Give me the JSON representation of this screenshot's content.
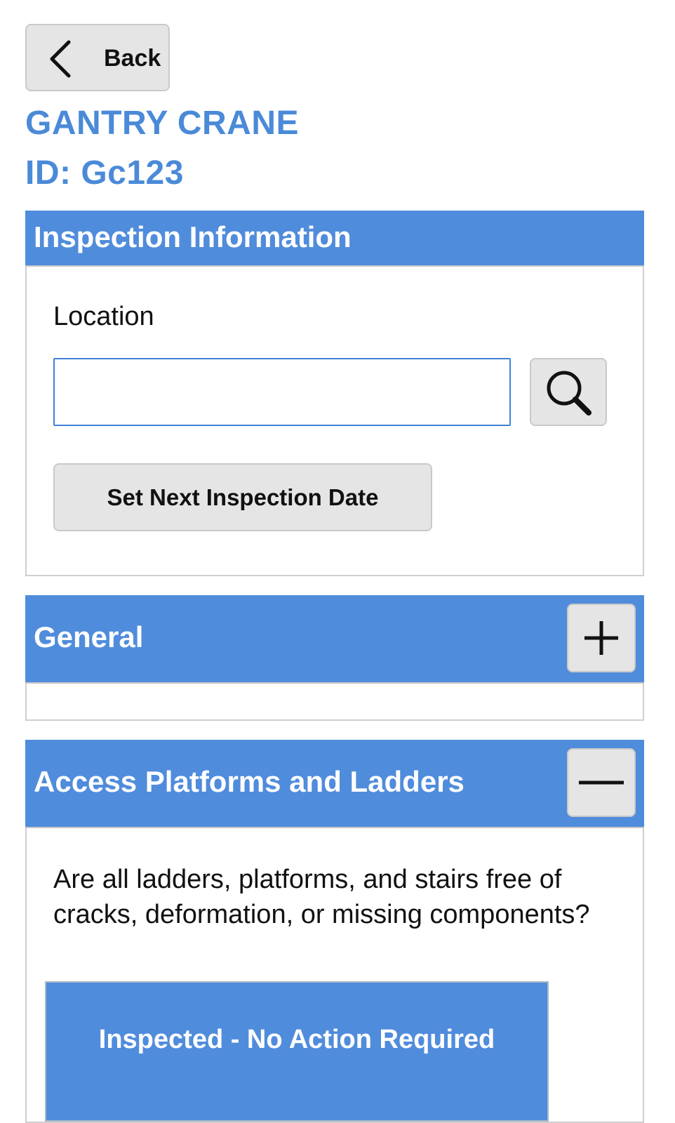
{
  "nav": {
    "back_label": "Back"
  },
  "asset": {
    "name": "GANTRY CRANE",
    "id_label": "ID: Gc123"
  },
  "inspection_info": {
    "header": "Inspection Information",
    "location_label": "Location",
    "location_value": "",
    "location_placeholder": "",
    "set_date_label": "Set Next Inspection Date"
  },
  "general": {
    "header": "General",
    "toggle_icon": "plus-icon"
  },
  "access": {
    "header": "Access Platforms and Ladders",
    "toggle_icon": "minus-icon",
    "question": "Are all ladders, platforms, and stairs free of cracks, deformation, or missing components?",
    "answer_label": "Inspected - No Action Required"
  },
  "colors": {
    "accent": "#508cdc",
    "title": "#4a8ad8",
    "button_gray": "#e5e5e5"
  }
}
